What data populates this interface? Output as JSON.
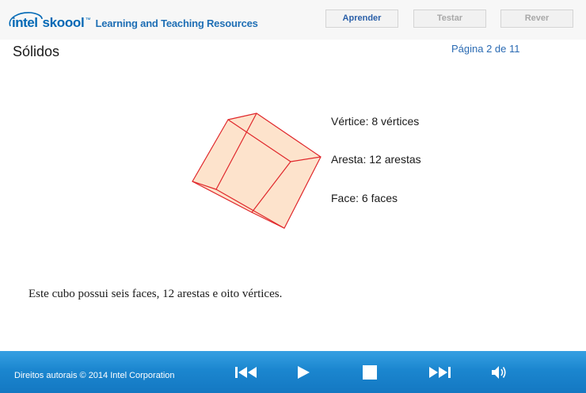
{
  "header": {
    "logo_brand": "intel",
    "logo_product": "skoool",
    "logo_tm": "™",
    "logo_tagline": "Learning and Teaching Resources",
    "tabs": [
      {
        "label": "Aprender",
        "state": "active"
      },
      {
        "label": "Testar",
        "state": "inactive"
      },
      {
        "label": "Rever",
        "state": "inactive"
      }
    ]
  },
  "content": {
    "title": "Sólidos",
    "page_indicator": "Página 2 de 11",
    "cube_properties": {
      "vertex": "Vértice: 8 vértices",
      "edge": "Aresta: 12 arestas",
      "face": "Face: 6 faces"
    },
    "caption": "Este cubo possui seis faces, 12 arestas e oito vértices."
  },
  "footer": {
    "copyright": "Direitos autorais © 2014 Intel Corporation",
    "controls": [
      {
        "name": "rewind",
        "icon": "rewind-icon"
      },
      {
        "name": "play",
        "icon": "play-icon"
      },
      {
        "name": "stop",
        "icon": "stop-icon"
      },
      {
        "name": "fast-forward",
        "icon": "fast-forward-icon"
      },
      {
        "name": "sound",
        "icon": "speaker-icon"
      }
    ]
  },
  "colors": {
    "brand_blue": "#0068b5",
    "page_indicator": "#2b6bb3",
    "cube_fill": "#fde3cc",
    "cube_edge": "#e0272b",
    "footer_blue": "#1b86cf"
  }
}
